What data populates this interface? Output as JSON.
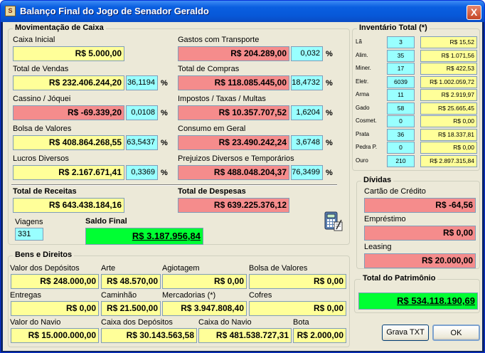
{
  "window": {
    "title": "Balanço Final do Jogo de Senador Geraldo",
    "icon": "game-icon",
    "close": "X"
  },
  "mov": {
    "title": "Movimentação de Caixa",
    "caixa_inicial": {
      "label": "Caixa Inicial",
      "value": "R$ 5.000,00"
    },
    "total_vendas": {
      "label": "Total de Vendas",
      "value": "R$ 232.406.244,20",
      "pct": "36,1194"
    },
    "cassino": {
      "label": "Cassino / Jóquei",
      "value": "R$ -69.339,20",
      "pct": "0,0108"
    },
    "bolsa": {
      "label": "Bolsa de Valores",
      "value": "R$ 408.864.268,55",
      "pct": "63,5437"
    },
    "lucros": {
      "label": "Lucros Diversos",
      "value": "R$ 2.167.671,41",
      "pct": "0,3369"
    },
    "transporte": {
      "label": "Gastos com Transporte",
      "value": "R$ 204.289,00",
      "pct": "0,032"
    },
    "compras": {
      "label": "Total de Compras",
      "value": "R$ 118.085.445,00",
      "pct": "18,4732"
    },
    "impostos": {
      "label": "Impostos / Taxas / Multas",
      "value": "R$ 10.357.707,52",
      "pct": "1,6204"
    },
    "consumo": {
      "label": "Consumo em Geral",
      "value": "R$ 23.490.242,24",
      "pct": "3,6748"
    },
    "prejuizos": {
      "label": "Prejuizos Diversos e Temporários",
      "value": "R$ 488.048.204,37",
      "pct": "76,3499"
    },
    "receitas": {
      "label": "Total de Receitas",
      "value": "R$ 643.438.184,16"
    },
    "despesas": {
      "label": "Total de Despesas",
      "value": "R$ 639.225.376,12"
    },
    "viagens": {
      "label": "Viagens",
      "value": "331"
    },
    "saldo": {
      "label": "Saldo Final",
      "value": "R$ 3.187.956,84"
    },
    "pct_sign": "%"
  },
  "bens": {
    "title": "Bens e Direitos",
    "deposito": {
      "label": "Valor dos Depósitos",
      "value": "R$ 248.000,00"
    },
    "arte": {
      "label": "Arte",
      "value": "R$ 48.570,00"
    },
    "agiotagem": {
      "label": "Agiotagem",
      "value": "R$ 0,00"
    },
    "bolsa": {
      "label": "Bolsa de Valores",
      "value": "R$ 0,00"
    },
    "entregas": {
      "label": "Entregas",
      "value": "R$ 0,00"
    },
    "caminhao": {
      "label": "Caminhão",
      "value": "R$ 21.500,00"
    },
    "mercadorias": {
      "label": "Mercadorias (*)",
      "value": "R$ 3.947.808,40"
    },
    "cofres": {
      "label": "Cofres",
      "value": "R$ 0,00"
    },
    "navio": {
      "label": "Valor do Navio",
      "value": "R$ 15.000.000,00"
    },
    "caixa_dep": {
      "label": "Caixa dos Depósitos",
      "value": "R$ 30.143.563,58"
    },
    "caixa_nav": {
      "label": "Caixa do Navio",
      "value": "R$ 481.538.727,31"
    },
    "bota": {
      "label": "Bota",
      "value": "R$ 2.000,00"
    }
  },
  "inv": {
    "title": "Inventário Total (*)",
    "rows": [
      {
        "label": "Lã",
        "qty": "3",
        "value": "R$ 15,52"
      },
      {
        "label": "Alim.",
        "qty": "35",
        "value": "R$ 1.071,56"
      },
      {
        "label": "Miner.",
        "qty": "17",
        "value": "R$ 422,53"
      },
      {
        "label": "Eletr.",
        "qty": "6039",
        "value": "R$ 1.002.059,72"
      },
      {
        "label": "Arma",
        "qty": "11",
        "value": "R$ 2.919,97"
      },
      {
        "label": "Gado",
        "qty": "58",
        "value": "R$ 25.665,45"
      },
      {
        "label": "Cosmet.",
        "qty": "0",
        "value": "R$ 0,00"
      },
      {
        "label": "Prata",
        "qty": "36",
        "value": "R$ 18.337,81"
      },
      {
        "label": "Pedra P.",
        "qty": "0",
        "value": "R$ 0,00"
      },
      {
        "label": "Ouro",
        "qty": "210",
        "value": "R$ 2.897.315,84"
      }
    ]
  },
  "dividas": {
    "title": "Dívidas",
    "cartao": {
      "label": "Cartão de Crédito",
      "value": "R$ -64,56"
    },
    "emprestimo": {
      "label": "Empréstimo",
      "value": "R$ 0,00"
    },
    "leasing": {
      "label": "Leasing",
      "value": "R$ 20.000,00"
    }
  },
  "patrimonio": {
    "title": "Total do Patrimônio",
    "value": "R$ 534.118.190,69"
  },
  "buttons": {
    "grava": "Grava TXT",
    "ok": "OK"
  },
  "colors": {
    "yellow": "#ffff99",
    "red": "#f58c8c",
    "cyan": "#99ffff",
    "green": "#00ff33",
    "title_bar": "#0a5fe0"
  }
}
